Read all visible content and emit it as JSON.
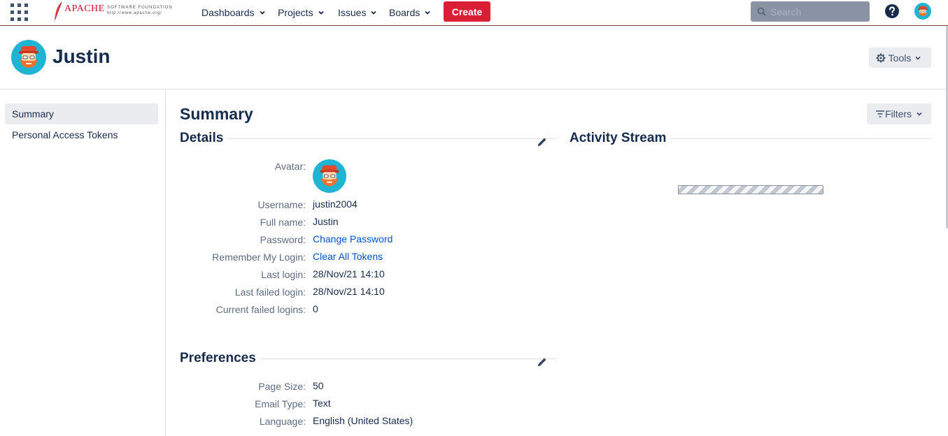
{
  "nav": {
    "logo": {
      "brand": "APACHE",
      "line1": "SOFTWARE FOUNDATION",
      "line2": "http://www.apache.org/"
    },
    "menus": [
      "Dashboards",
      "Projects",
      "Issues",
      "Boards"
    ],
    "create_label": "Create",
    "search_placeholder": "Search",
    "icons": [
      "app-switcher-icon",
      "chevron-down-icon",
      "search-icon",
      "help-icon",
      "avatar"
    ]
  },
  "profile": {
    "name": "Justin",
    "tools_label": "Tools"
  },
  "sidebar": {
    "items": [
      {
        "label": "Summary",
        "active": true
      },
      {
        "label": "Personal Access Tokens",
        "active": false
      }
    ]
  },
  "main": {
    "title": "Summary",
    "filters_label": "Filters",
    "details": {
      "heading": "Details",
      "avatar_label": "Avatar:",
      "rows": [
        {
          "label": "Username:",
          "value": "justin2004",
          "link": false
        },
        {
          "label": "Full name:",
          "value": "Justin",
          "link": false
        },
        {
          "label": "Password:",
          "value": "Change Password",
          "link": true
        },
        {
          "label": "Remember My Login:",
          "value": "Clear All Tokens",
          "link": true
        },
        {
          "label": "Last login:",
          "value": "28/Nov/21 14:10",
          "link": false
        },
        {
          "label": "Last failed login:",
          "value": "28/Nov/21 14:10",
          "link": false
        },
        {
          "label": "Current failed logins:",
          "value": "0",
          "link": false
        }
      ]
    },
    "preferences": {
      "heading": "Preferences",
      "rows": [
        {
          "label": "Page Size:",
          "value": "50"
        },
        {
          "label": "Email Type:",
          "value": "Text"
        },
        {
          "label": "Language:",
          "value": "English (United States)"
        }
      ]
    },
    "activity": {
      "heading": "Activity Stream"
    }
  },
  "colors": {
    "create": "#d91e36",
    "link": "#0052cc",
    "text": "#172b4d",
    "label": "#5e6c84"
  }
}
